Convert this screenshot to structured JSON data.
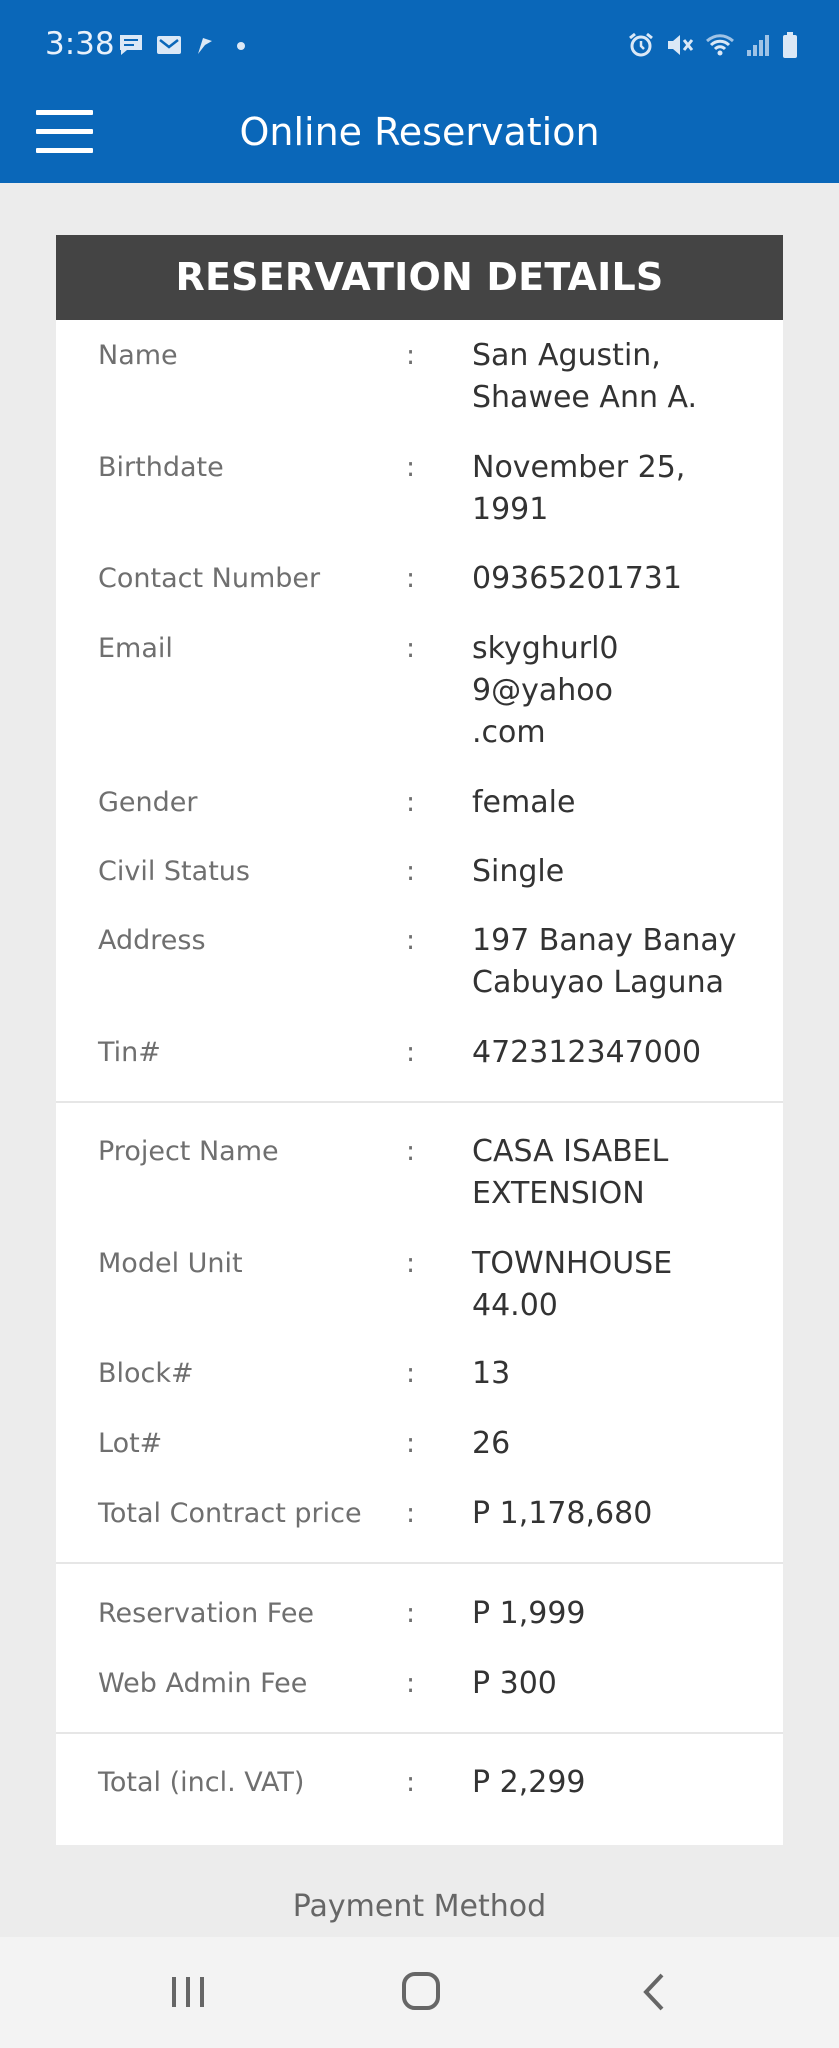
{
  "status_bar": {
    "time": "3:38",
    "left_icons": [
      "chat-icon",
      "mail-icon",
      "flag-icon",
      "dot-icon"
    ],
    "right_icons": [
      "alarm-icon",
      "mute-icon",
      "wifi-icon",
      "signal-icon",
      "battery-icon"
    ]
  },
  "app_bar": {
    "title": "Online Reservation"
  },
  "card": {
    "header": "RESERVATION DETAILS",
    "colon": ":",
    "personal": [
      {
        "label": "Name",
        "value": "San Agustin,\nShawee Ann A."
      },
      {
        "label": "Birthdate",
        "value": "November 25,\n1991"
      },
      {
        "label": "Contact Number",
        "value": "09365201731"
      },
      {
        "label": "Email",
        "value": "skyghurl0\n9@yahoo\n.com"
      },
      {
        "label": "Gender",
        "value": "female"
      },
      {
        "label": "Civil Status",
        "value": "Single"
      },
      {
        "label": "Address",
        "value": "197 Banay Banay\nCabuyao Laguna"
      },
      {
        "label": "Tin#",
        "value": "472312347000"
      }
    ],
    "property": [
      {
        "label": "Project Name",
        "value": "CASA ISABEL\nEXTENSION"
      },
      {
        "label": "Model Unit",
        "value": "TOWNHOUSE\n44.00"
      },
      {
        "label": "Block#",
        "value": "13"
      },
      {
        "label": "Lot#",
        "value": "26"
      },
      {
        "label": "Total Contract price",
        "value": "P 1,178,680"
      }
    ],
    "fees": [
      {
        "label": "Reservation Fee",
        "value": "P 1,999"
      },
      {
        "label": "Web Admin Fee",
        "value": "P 300"
      }
    ],
    "total": [
      {
        "label": "Total (incl. VAT)",
        "value": "P 2,299"
      }
    ]
  },
  "payment_method_label": "Payment Method",
  "nav_bar": {
    "buttons": [
      "recent-apps-icon",
      "home-icon",
      "back-icon"
    ]
  },
  "colors": {
    "primary": "#0a67b9",
    "header_bg": "#444444",
    "page_bg": "#ececec"
  }
}
